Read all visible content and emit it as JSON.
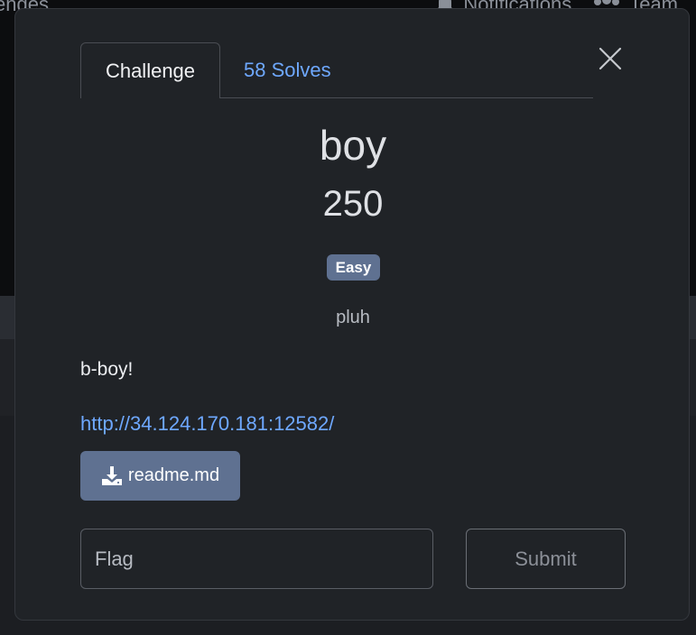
{
  "background_nav": {
    "left_fragment": "enges",
    "notifications_label": "Notifications",
    "team_label": "Team"
  },
  "modal": {
    "tabs": [
      {
        "label": "Challenge",
        "active": true
      },
      {
        "label": "58 Solves",
        "active": false
      }
    ],
    "close_icon": "close-icon",
    "challenge": {
      "name": "boy",
      "points": "250",
      "difficulty_badge": "Easy",
      "author": "pluh",
      "description": "b-boy!",
      "link": "http://34.124.170.181:12582/",
      "file_label": "readme.md",
      "file_icon": "download-icon"
    },
    "flag_input": {
      "value": "",
      "placeholder": "Flag"
    },
    "submit_label": "Submit"
  },
  "colors": {
    "modal_bg": "#202327",
    "link": "#6ea8ff",
    "badge_bg": "#5f7191",
    "file_button_bg": "#5f7191"
  }
}
